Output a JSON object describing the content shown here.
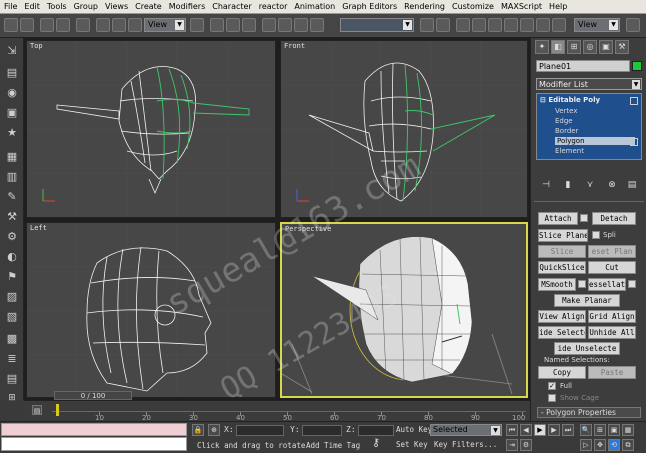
{
  "menu": [
    "File",
    "Edit",
    "Tools",
    "Group",
    "Views",
    "Create",
    "Modifiers",
    "Character",
    "reactor",
    "Animation",
    "Graph Editors",
    "Rendering",
    "Customize",
    "MAXScript",
    "Help"
  ],
  "toolbar": {
    "view_left": "View",
    "view_right": "View"
  },
  "viewports": {
    "top": "Top",
    "front": "Front",
    "left": "Left",
    "perspective": "Perspective"
  },
  "command_panel": {
    "object_name": "Plane01",
    "object_color": "#1ec83c",
    "modifier_list": "Modifier List",
    "stack": {
      "title": "Editable Poly",
      "items": [
        "Vertex",
        "Edge",
        "Border",
        "Polygon",
        "Element"
      ],
      "selected": "Polygon"
    },
    "buttons": {
      "attach": "Attach",
      "detach": "Detach",
      "slice_plane": "Slice Plane",
      "split": "Spli",
      "slice": "Slice",
      "reset_plane": "eset Plan",
      "quickslice": "QuickSlice",
      "cut": "Cut",
      "msmooth": "MSmooth",
      "tessellate": "essellat",
      "make_planar": "Make Planar",
      "view_align": "View Align",
      "grid_align": "Grid Align",
      "hide_selected": "ide Selecte",
      "unhide_all": "Unhide All",
      "hide_unselected": "ide Unselecte",
      "copy": "Copy",
      "paste": "Paste"
    },
    "named_selections": "Named Selections:",
    "full": "Full",
    "show_cage": "Show Cage",
    "rollout_title": "Polygon Properties"
  },
  "timeline": {
    "slider": "0 / 100",
    "ticks": [
      "10",
      "20",
      "30",
      "40",
      "50",
      "60",
      "70",
      "80",
      "90",
      "100"
    ]
  },
  "status": {
    "x_label": "X:",
    "y_label": "Y:",
    "z_label": "Z:",
    "prompt": "Click and drag to rotate",
    "add_time_tag": "Add Time Tag",
    "auto_key": "Auto Key",
    "set_key": "Set Key",
    "key_filters": "Key Filters...",
    "selected": "Selected"
  },
  "watermark": {
    "line1": "squeal@163.com",
    "line2": "QQ 11223493"
  }
}
